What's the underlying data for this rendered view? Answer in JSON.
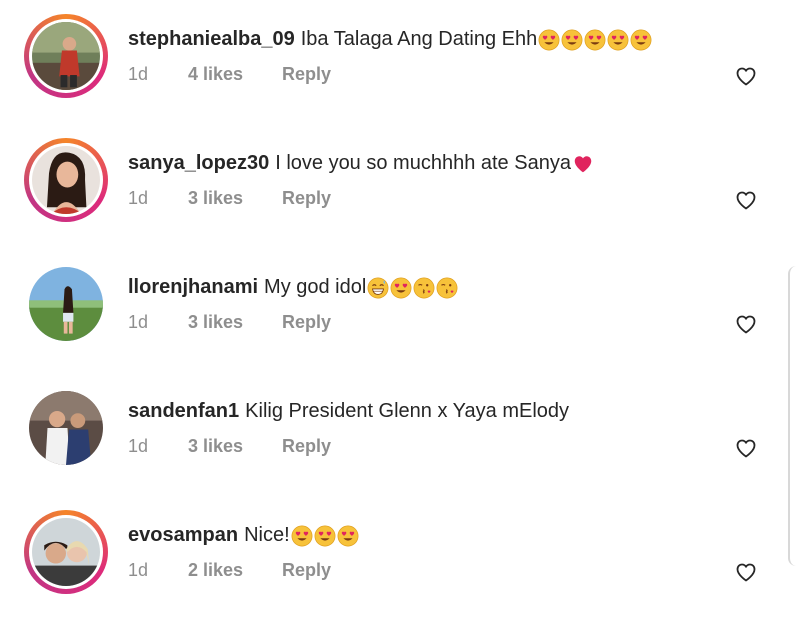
{
  "comments": [
    {
      "username": "stephaniealba_09",
      "text": "Iba Talaga Ang Dating Ehh",
      "emojis": [
        "heart-eyes",
        "heart-eyes",
        "heart-eyes",
        "heart-eyes",
        "heart-eyes"
      ],
      "time": "1d",
      "likes": "4 likes",
      "reply": "Reply",
      "ring": true
    },
    {
      "username": "sanya_lopez30",
      "text": "I love you so muchhhh ate Sanya",
      "emojis": [
        "red-heart"
      ],
      "time": "1d",
      "likes": "3 likes",
      "reply": "Reply",
      "ring": true
    },
    {
      "username": "llorenjhanami",
      "text": "My god idol",
      "emojis": [
        "grinning-sweat",
        "heart-eyes",
        "kissing-heart",
        "kissing-heart"
      ],
      "time": "1d",
      "likes": "3 likes",
      "reply": "Reply",
      "ring": false
    },
    {
      "username": "sandenfan1",
      "text": "Kilig President Glenn x Yaya mElody",
      "emojis": [],
      "time": "1d",
      "likes": "3 likes",
      "reply": "Reply",
      "ring": false
    },
    {
      "username": "evosampan",
      "text": "Nice!",
      "emojis": [
        "heart-eyes",
        "heart-eyes",
        "heart-eyes"
      ],
      "time": "1d",
      "likes": "2 likes",
      "reply": "Reply",
      "ring": true
    }
  ],
  "colors": {
    "text": "#262626",
    "meta": "#8e8e8e",
    "emoji_face": "#f7c23a",
    "heart_red": "#e0245e"
  }
}
